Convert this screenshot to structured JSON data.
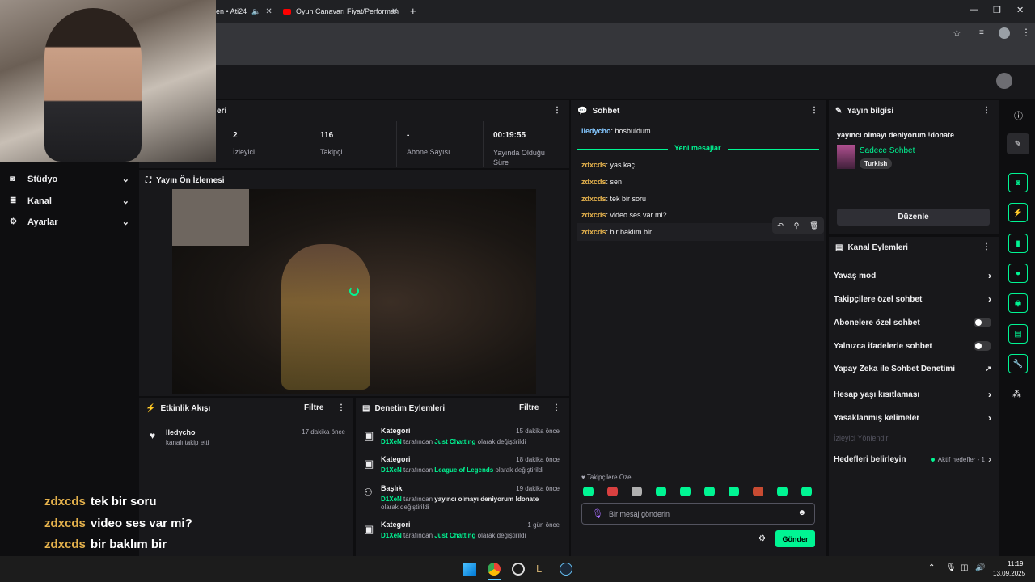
{
  "browser": {
    "tabs": [
      {
        "label": "en • Ati24"
      },
      {
        "label": "Oyun Canavarı Fiyat/Performan"
      }
    ],
    "new_tab": "+",
    "win": {
      "min": "—",
      "max": "❐",
      "close": "✕"
    }
  },
  "stats": [
    {
      "value": "2",
      "label": "İzleyici"
    },
    {
      "value": "116",
      "label": "Takipçi"
    },
    {
      "value": "-",
      "label": "Abone Sayısı"
    },
    {
      "value": "00:19:55",
      "label": "Yayında Olduğu Süre"
    }
  ],
  "sidebar": {
    "cut_title": "eri",
    "items": [
      {
        "label": "Stüdyo"
      },
      {
        "label": "Kanal"
      },
      {
        "label": "Ayarlar"
      }
    ]
  },
  "preview": {
    "title": "Yayın Ön İzlemesi"
  },
  "activity": {
    "title": "Etkinlik Akışı",
    "filter": "Filtre",
    "items": [
      {
        "user": "lledycho",
        "desc": "kanalı takip etti",
        "time": "17 dakika önce"
      }
    ]
  },
  "moderation": {
    "title": "Denetim Eylemleri",
    "filter": "Filtre",
    "items": [
      {
        "title": "Kategori",
        "actor": "D1XeN",
        "mid": "tarafından",
        "value": "Just Chatting",
        "tail": "olarak değiştirildi",
        "time": "15 dakika önce"
      },
      {
        "title": "Kategori",
        "actor": "D1XeN",
        "mid": "tarafından",
        "value": "League of Legends",
        "tail": "olarak değiştirildi",
        "time": "18 dakika önce"
      },
      {
        "title": "Başlık",
        "actor": "D1XeN",
        "mid": "tarafından",
        "value": "yayıncı olmayı deniyorum !donate",
        "tail": "olarak değiştirildi",
        "time": "19 dakika önce"
      },
      {
        "title": "Kategori",
        "actor": "D1XeN",
        "mid": "tarafından",
        "value": "Just Chatting",
        "tail": "olarak değiştirildi",
        "time": "1 gün önce"
      }
    ]
  },
  "chat": {
    "title": "Sohbet",
    "first": {
      "user": "lledycho",
      "text": "hosbuldum"
    },
    "divider": "Yeni mesajlar",
    "messages": [
      {
        "user": "zdxcds",
        "text": "yas kaç"
      },
      {
        "user": "zdxcds",
        "text": "sen"
      },
      {
        "user": "zdxcds",
        "text": "tek bir soru"
      },
      {
        "user": "zdxcds",
        "text": "video ses var mi?"
      },
      {
        "user": "zdxcds",
        "text": "bir baklım bir"
      }
    ],
    "mode_label": "Takipçilere Özel",
    "input_placeholder": "Bir mesaj gönderin",
    "send": "Gönder"
  },
  "stream_info": {
    "title": "Yayın bilgisi",
    "stream_title": "yayıncı olmayı deniyorum !donate",
    "category": "Sadece Sohbet",
    "tag": "Turkish",
    "edit": "Düzenle"
  },
  "channel_actions": {
    "title": "Kanal Eylemleri",
    "rows": [
      {
        "label": "Yavaş mod",
        "type": "arrow"
      },
      {
        "label": "Takipçilere özel sohbet",
        "type": "arrow"
      },
      {
        "label": "Abonelere özel sohbet",
        "type": "toggle"
      },
      {
        "label": "Yalnızca ifadelerle sohbet",
        "type": "toggle"
      },
      {
        "label": "Yapay Zeka ile Sohbet Denetimi",
        "type": "ext"
      },
      {
        "label": "Hesap yaşı kısıtlaması",
        "type": "arrow"
      },
      {
        "label": "Yasaklanmış kelimeler",
        "type": "arrow"
      }
    ],
    "disabled": "İzleyici Yönlendir",
    "goals": {
      "label": "Hedefleri belirleyin",
      "status": "Aktif hedefler - 1"
    }
  },
  "overlay_chat": [
    {
      "user": "zdxcds",
      "text": "tek bir soru"
    },
    {
      "user": "zdxcds",
      "text": "video ses var mi?"
    },
    {
      "user": "zdxcds",
      "text": "bir baklım bir"
    }
  ],
  "clock": {
    "time": "11:19",
    "date": "13.09.2025"
  },
  "colors": {
    "accent": "#00f593",
    "bg": "#0e0e10",
    "panel": "#18181b"
  }
}
